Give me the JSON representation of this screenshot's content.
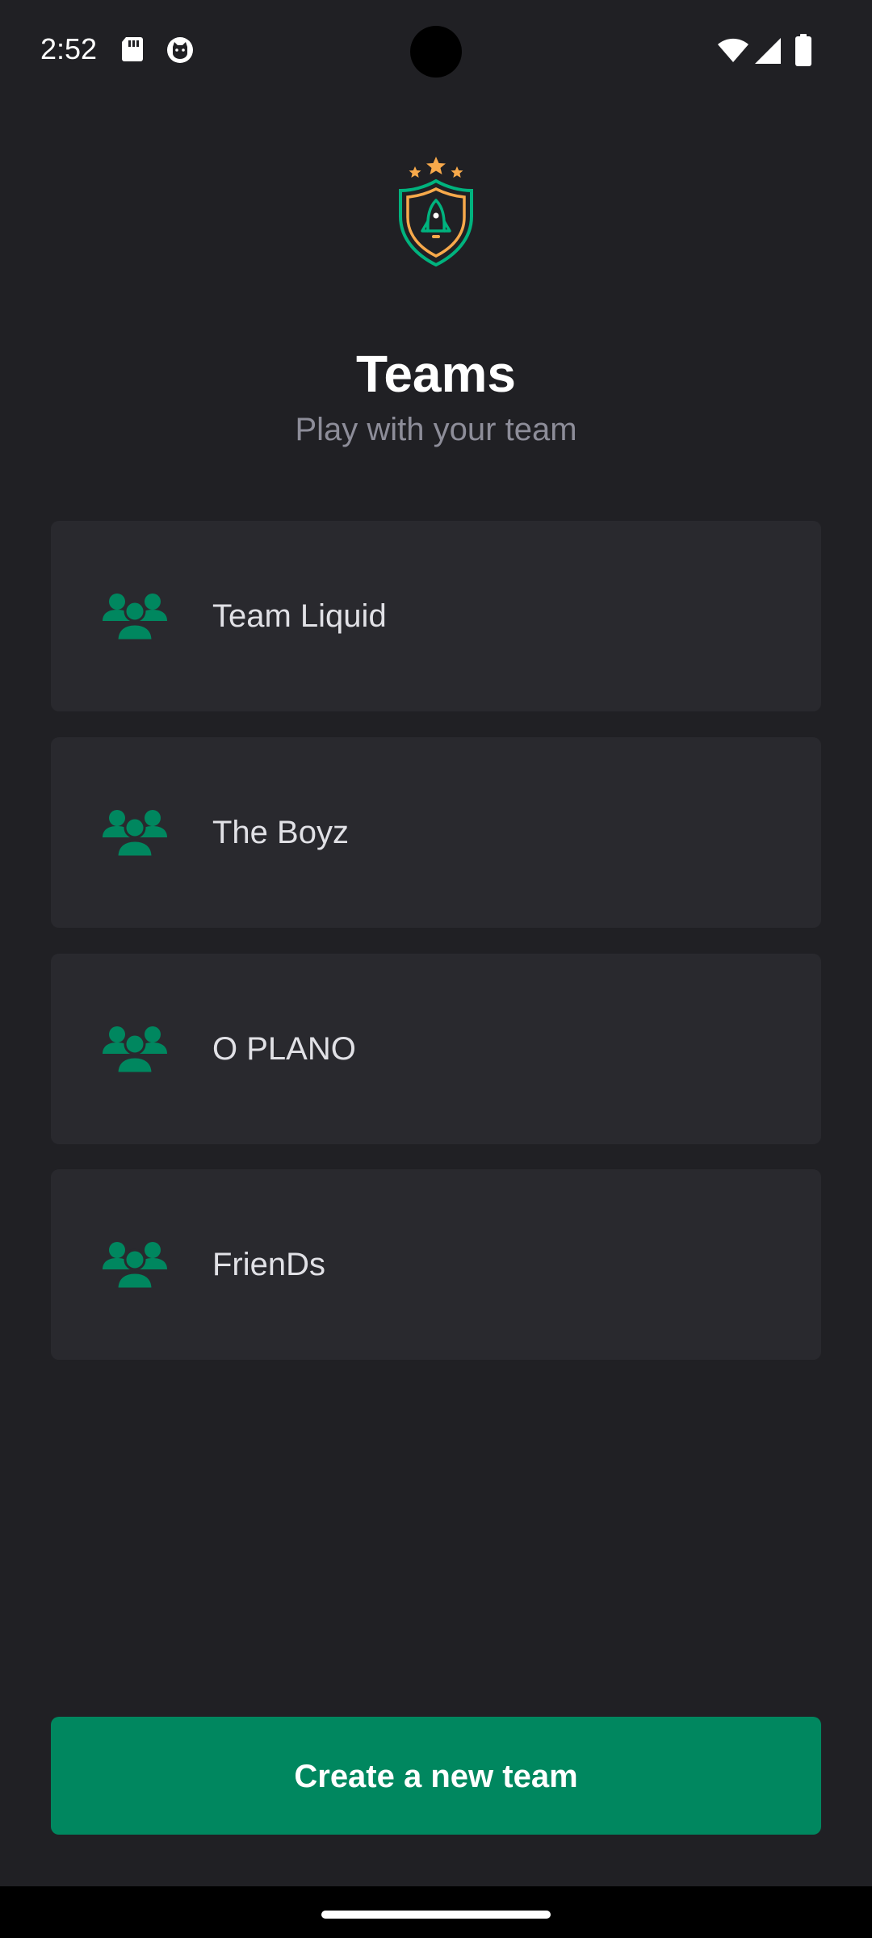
{
  "status_bar": {
    "time": "2:52",
    "left_icons": [
      "sd-card-icon",
      "cat-face-icon"
    ],
    "right_icons": [
      "wifi-icon",
      "cell-signal-icon",
      "battery-icon"
    ]
  },
  "logo": {
    "icon": "shield-rocket-logo-icon",
    "colors": {
      "stars": "#f7a94b",
      "shield_outer": "#00b37e",
      "shield_inner": "#f7a94b",
      "rocket": "#00b37e"
    }
  },
  "header": {
    "title": "Teams",
    "subtitle": "Play with your team"
  },
  "teams": [
    {
      "name": "Team Liquid",
      "icon": "users-group-icon"
    },
    {
      "name": "The Boyz",
      "icon": "users-group-icon"
    },
    {
      "name": "O PLANO",
      "icon": "users-group-icon"
    },
    {
      "name": "FrienDs",
      "icon": "users-group-icon"
    }
  ],
  "create_button": {
    "label": "Create a new team"
  },
  "colors": {
    "background": "#202024",
    "card": "#29292e",
    "accent": "#00875f",
    "icon_green": "#00875f",
    "subtitle_gray": "#8d8d99",
    "text": "#e1e1e6"
  }
}
